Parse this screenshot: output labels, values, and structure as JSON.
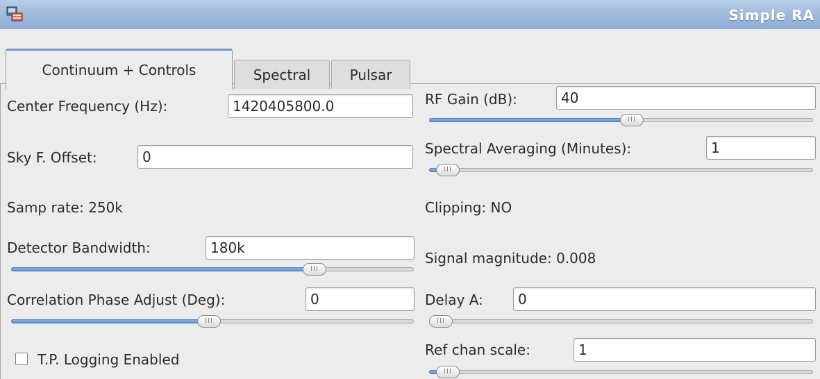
{
  "window": {
    "title": "Simple RA",
    "title_bar_color": "#9db8dc"
  },
  "tabs": [
    {
      "label": "Continuum + Controls",
      "active": true
    },
    {
      "label": "Spectral",
      "active": false
    },
    {
      "label": "Pulsar",
      "active": false
    }
  ],
  "left": {
    "center_freq": {
      "label": "Center Frequency (Hz):",
      "value": "1420405800.0"
    },
    "sky_offset": {
      "label": "Sky F. Offset:",
      "value": "0"
    },
    "samp_rate": {
      "text": "Samp rate: 250k"
    },
    "detector_bw": {
      "label": "Detector Bandwidth:",
      "value": "180k",
      "slider_level": 0.77
    },
    "corr_phase": {
      "label": "Correlation Phase Adjust (Deg):",
      "value": "0",
      "slider_level": 0.49
    },
    "tp_logging": {
      "label": "T.P. Logging Enabled",
      "checked": false
    }
  },
  "right": {
    "rf_gain": {
      "label": "RF Gain (dB):",
      "value": "40",
      "slider_level": 0.53
    },
    "spectral_avg": {
      "label": "Spectral Averaging (Minutes):",
      "value": "1",
      "slider_level": 0.02
    },
    "clipping": {
      "text": "Clipping: NO"
    },
    "signal_mag": {
      "text": "Signal magnitude: 0.008"
    },
    "delay_a": {
      "label": "Delay A:",
      "value": "0",
      "slider_level": 0.0
    },
    "ref_chan_scale": {
      "label": "Ref chan scale:",
      "value": "1",
      "slider_level": 0.02
    }
  },
  "slider_thumb_glyph": "III",
  "accent_color": "#5f8fcf"
}
